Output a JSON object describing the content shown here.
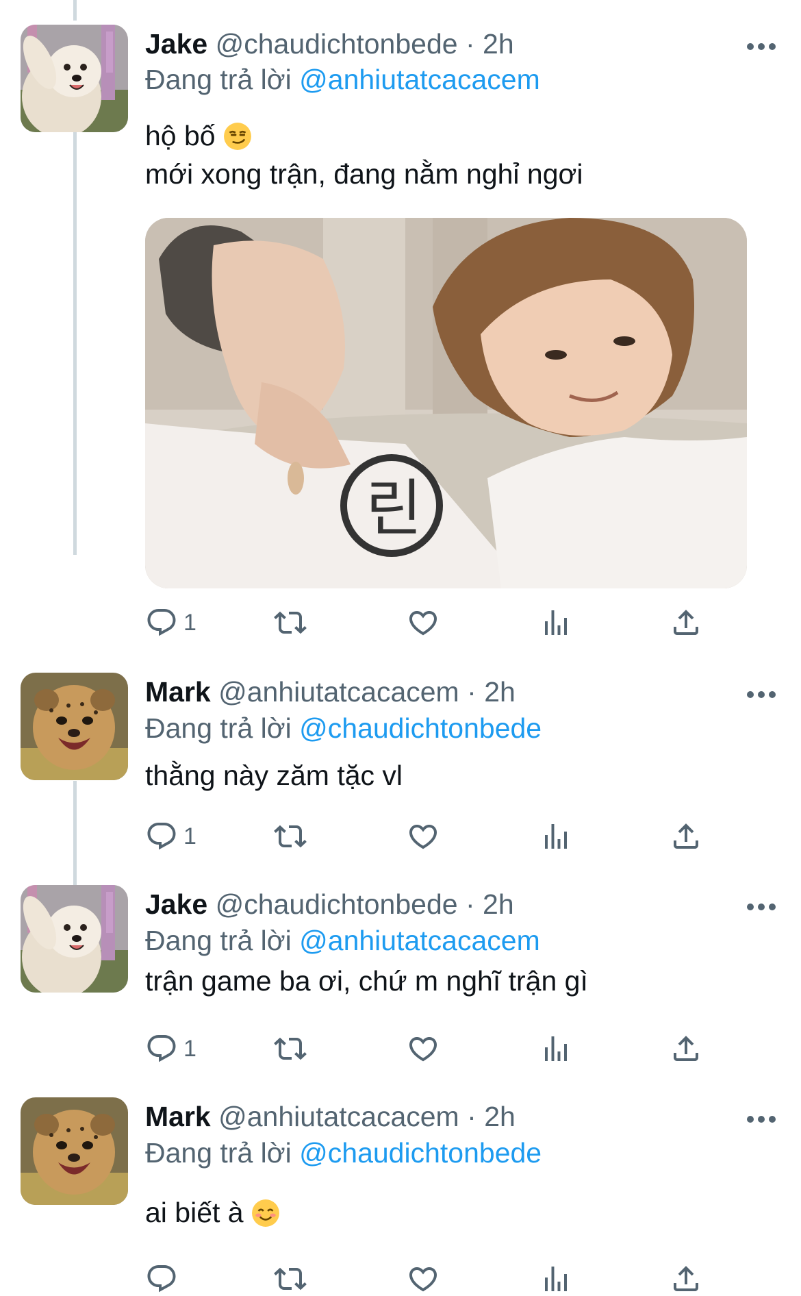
{
  "tweets": [
    {
      "display_name": "Jake",
      "handle": "@chaudichtonbede",
      "separator": "·",
      "time": "2h",
      "reply_prefix": "Đang trả lời",
      "reply_to": "@anhiutatcacacem",
      "text_lines": [
        "hộ bố",
        "mới xong trận, đang nằm nghỉ ngơi"
      ],
      "emoji": "smirking-face",
      "avatar": "samoyed-dog-avatar",
      "has_media": true,
      "reply_count": "1"
    },
    {
      "display_name": "Mark",
      "handle": "@anhiutatcacacem",
      "separator": "·",
      "time": "2h",
      "reply_prefix": "Đang trả lời",
      "reply_to": "@chaudichtonbede",
      "text_lines": [
        "thằng này zăm tặc vl"
      ],
      "avatar": "cheetah-cub-avatar",
      "reply_count": "1"
    },
    {
      "display_name": "Jake",
      "handle": "@chaudichtonbede",
      "separator": "·",
      "time": "2h",
      "reply_prefix": "Đang trả lời",
      "reply_to": "@anhiutatcacacem",
      "text_lines": [
        "trận game ba ơi, chứ m nghĩ trận gì"
      ],
      "avatar": "samoyed-dog-avatar",
      "reply_count": "1"
    },
    {
      "display_name": "Mark",
      "handle": "@anhiutatcacacem",
      "separator": "·",
      "time": "2h",
      "reply_prefix": "Đang trả lời",
      "reply_to": "@chaudichtonbede",
      "text_lines": [
        "ai biết à"
      ],
      "emoji": "smiling-face",
      "avatar": "cheetah-cub-avatar",
      "reply_count": ""
    }
  ],
  "media_image": {
    "description_icon": "photo-two-people-resting",
    "shirt_print": "린"
  },
  "colors": {
    "accent": "#1d9bf0",
    "secondary_text": "#536471",
    "primary_text": "#0f1419",
    "thread_line": "#cfd9de"
  },
  "icons": {
    "reply": "reply-icon",
    "retweet": "retweet-icon",
    "like": "like-icon",
    "views": "views-icon",
    "share": "share-icon",
    "more": "more-options-icon"
  }
}
